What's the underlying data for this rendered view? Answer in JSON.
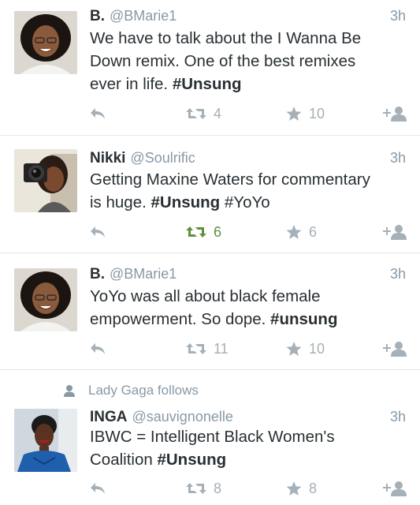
{
  "tweets": [
    {
      "name": "B.",
      "handle": "@BMarie1",
      "time": "3h",
      "line1": "We have to talk about the I Wanna Be",
      "line2": "Down remix. One of the best remixes",
      "line3_text": "ever in life. ",
      "line3_tag": "#Unsung",
      "retweets": "4",
      "favorites": "10",
      "retweeted": false
    },
    {
      "name": "Nikki",
      "handle": "@Soulrific",
      "time": "3h",
      "line1": "Getting Maxine Waters for commentary",
      "line2_pre": "is huge. ",
      "line2_tag": "#Unsung",
      "line2_post": " #YoYo",
      "retweets": "6",
      "favorites": "6",
      "retweeted": true
    },
    {
      "name": "B.",
      "handle": "@BMarie1",
      "time": "3h",
      "line1": "YoYo was all about black female",
      "line2_pre": "empowerment. So dope. ",
      "line2_tag": "#unsung",
      "retweets": "11",
      "favorites": "10",
      "retweeted": false
    },
    {
      "social_context": "Lady Gaga follows",
      "name": "INGA",
      "handle": "@sauvignonelle",
      "time": "3h",
      "line1": "IBWC = Intelligent Black Women's",
      "line2_pre": "Coalition ",
      "line2_tag": "#Unsung",
      "retweets": "8",
      "favorites": "8",
      "retweeted": false
    }
  ],
  "icons": {
    "reply": "reply-icon",
    "retweet": "retweet-icon",
    "favorite": "star-icon",
    "follow": "follow-icon",
    "social": "person-icon"
  },
  "colors": {
    "text": "#292f33",
    "muted": "#8899a6",
    "action": "#a5b0b8",
    "retweeted": "#5c913b",
    "divider": "#e1e8ed"
  }
}
